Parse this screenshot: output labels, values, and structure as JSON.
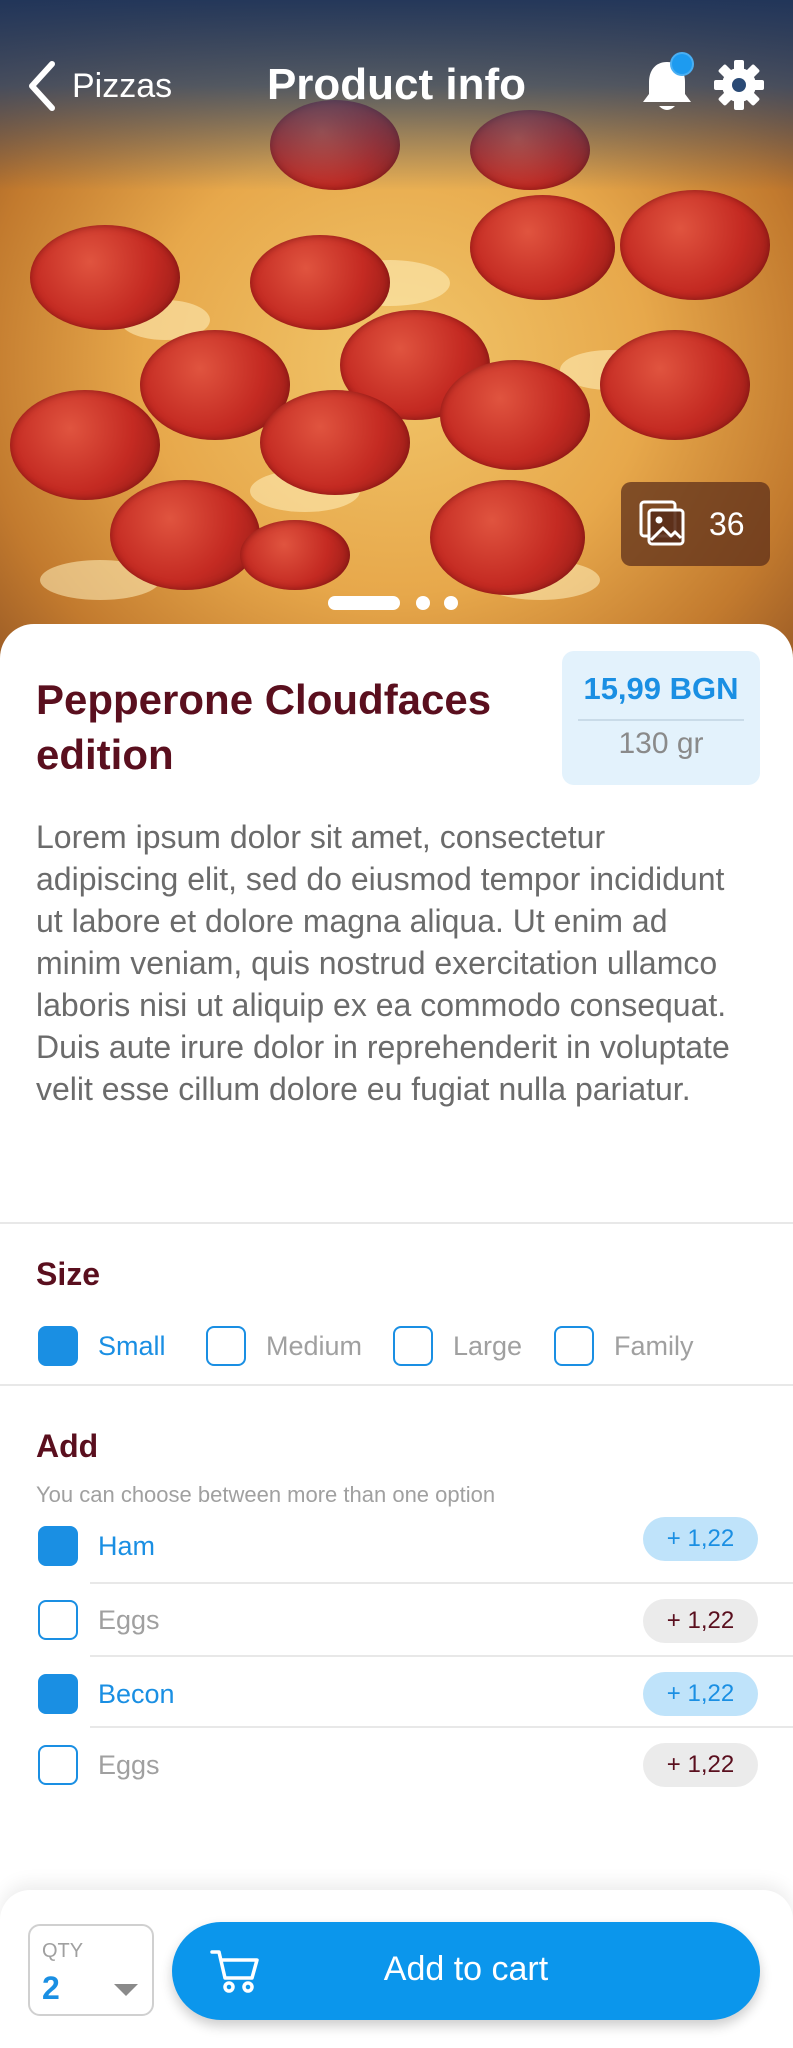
{
  "nav": {
    "back_label": "Pizzas",
    "title": "Product info"
  },
  "gallery": {
    "count": "36"
  },
  "carousel": {
    "pages": 3,
    "active": 0
  },
  "product": {
    "title": "Pepperone Cloudfaces edition",
    "price": "15,99 BGN",
    "weight": "130 gr",
    "description": "Lorem ipsum dolor sit amet, consectetur adipiscing elit, sed do eiusmod tempor incididunt ut labore et dolore magna aliqua. Ut enim ad minim veniam, quis nostrud exercitation ullamco laboris nisi ut aliquip ex ea commodo consequat. Duis aute irure dolor in reprehenderit in voluptate velit esse cillum dolore eu fugiat nulla pariatur."
  },
  "size": {
    "title": "Size",
    "options": [
      {
        "label": "Small",
        "checked": true
      },
      {
        "label": "Medium",
        "checked": false
      },
      {
        "label": "Large",
        "checked": false
      },
      {
        "label": "Family",
        "checked": false
      }
    ]
  },
  "add": {
    "title": "Add",
    "hint": "You can choose between more than one option",
    "options": [
      {
        "label": "Ham",
        "price": "+ 1,22",
        "checked": true
      },
      {
        "label": "Eggs",
        "price": "+ 1,22",
        "checked": false
      },
      {
        "label": "Becon",
        "price": "+ 1,22",
        "checked": true
      },
      {
        "label": "Eggs",
        "price": "+ 1,22",
        "checked": false
      }
    ]
  },
  "footer": {
    "qty_label": "QTY",
    "qty_value": "2",
    "add_to_cart_label": "Add to cart"
  },
  "colors": {
    "accent": "#1a8fe3",
    "title": "#5a0f1e",
    "button": "#0b96ec"
  },
  "icons": {
    "back": "chevron-left-icon",
    "notifications": "bell-icon",
    "settings": "gear-icon",
    "gallery": "images-icon",
    "cart": "cart-icon",
    "qty_dropdown": "caret-down-icon"
  }
}
